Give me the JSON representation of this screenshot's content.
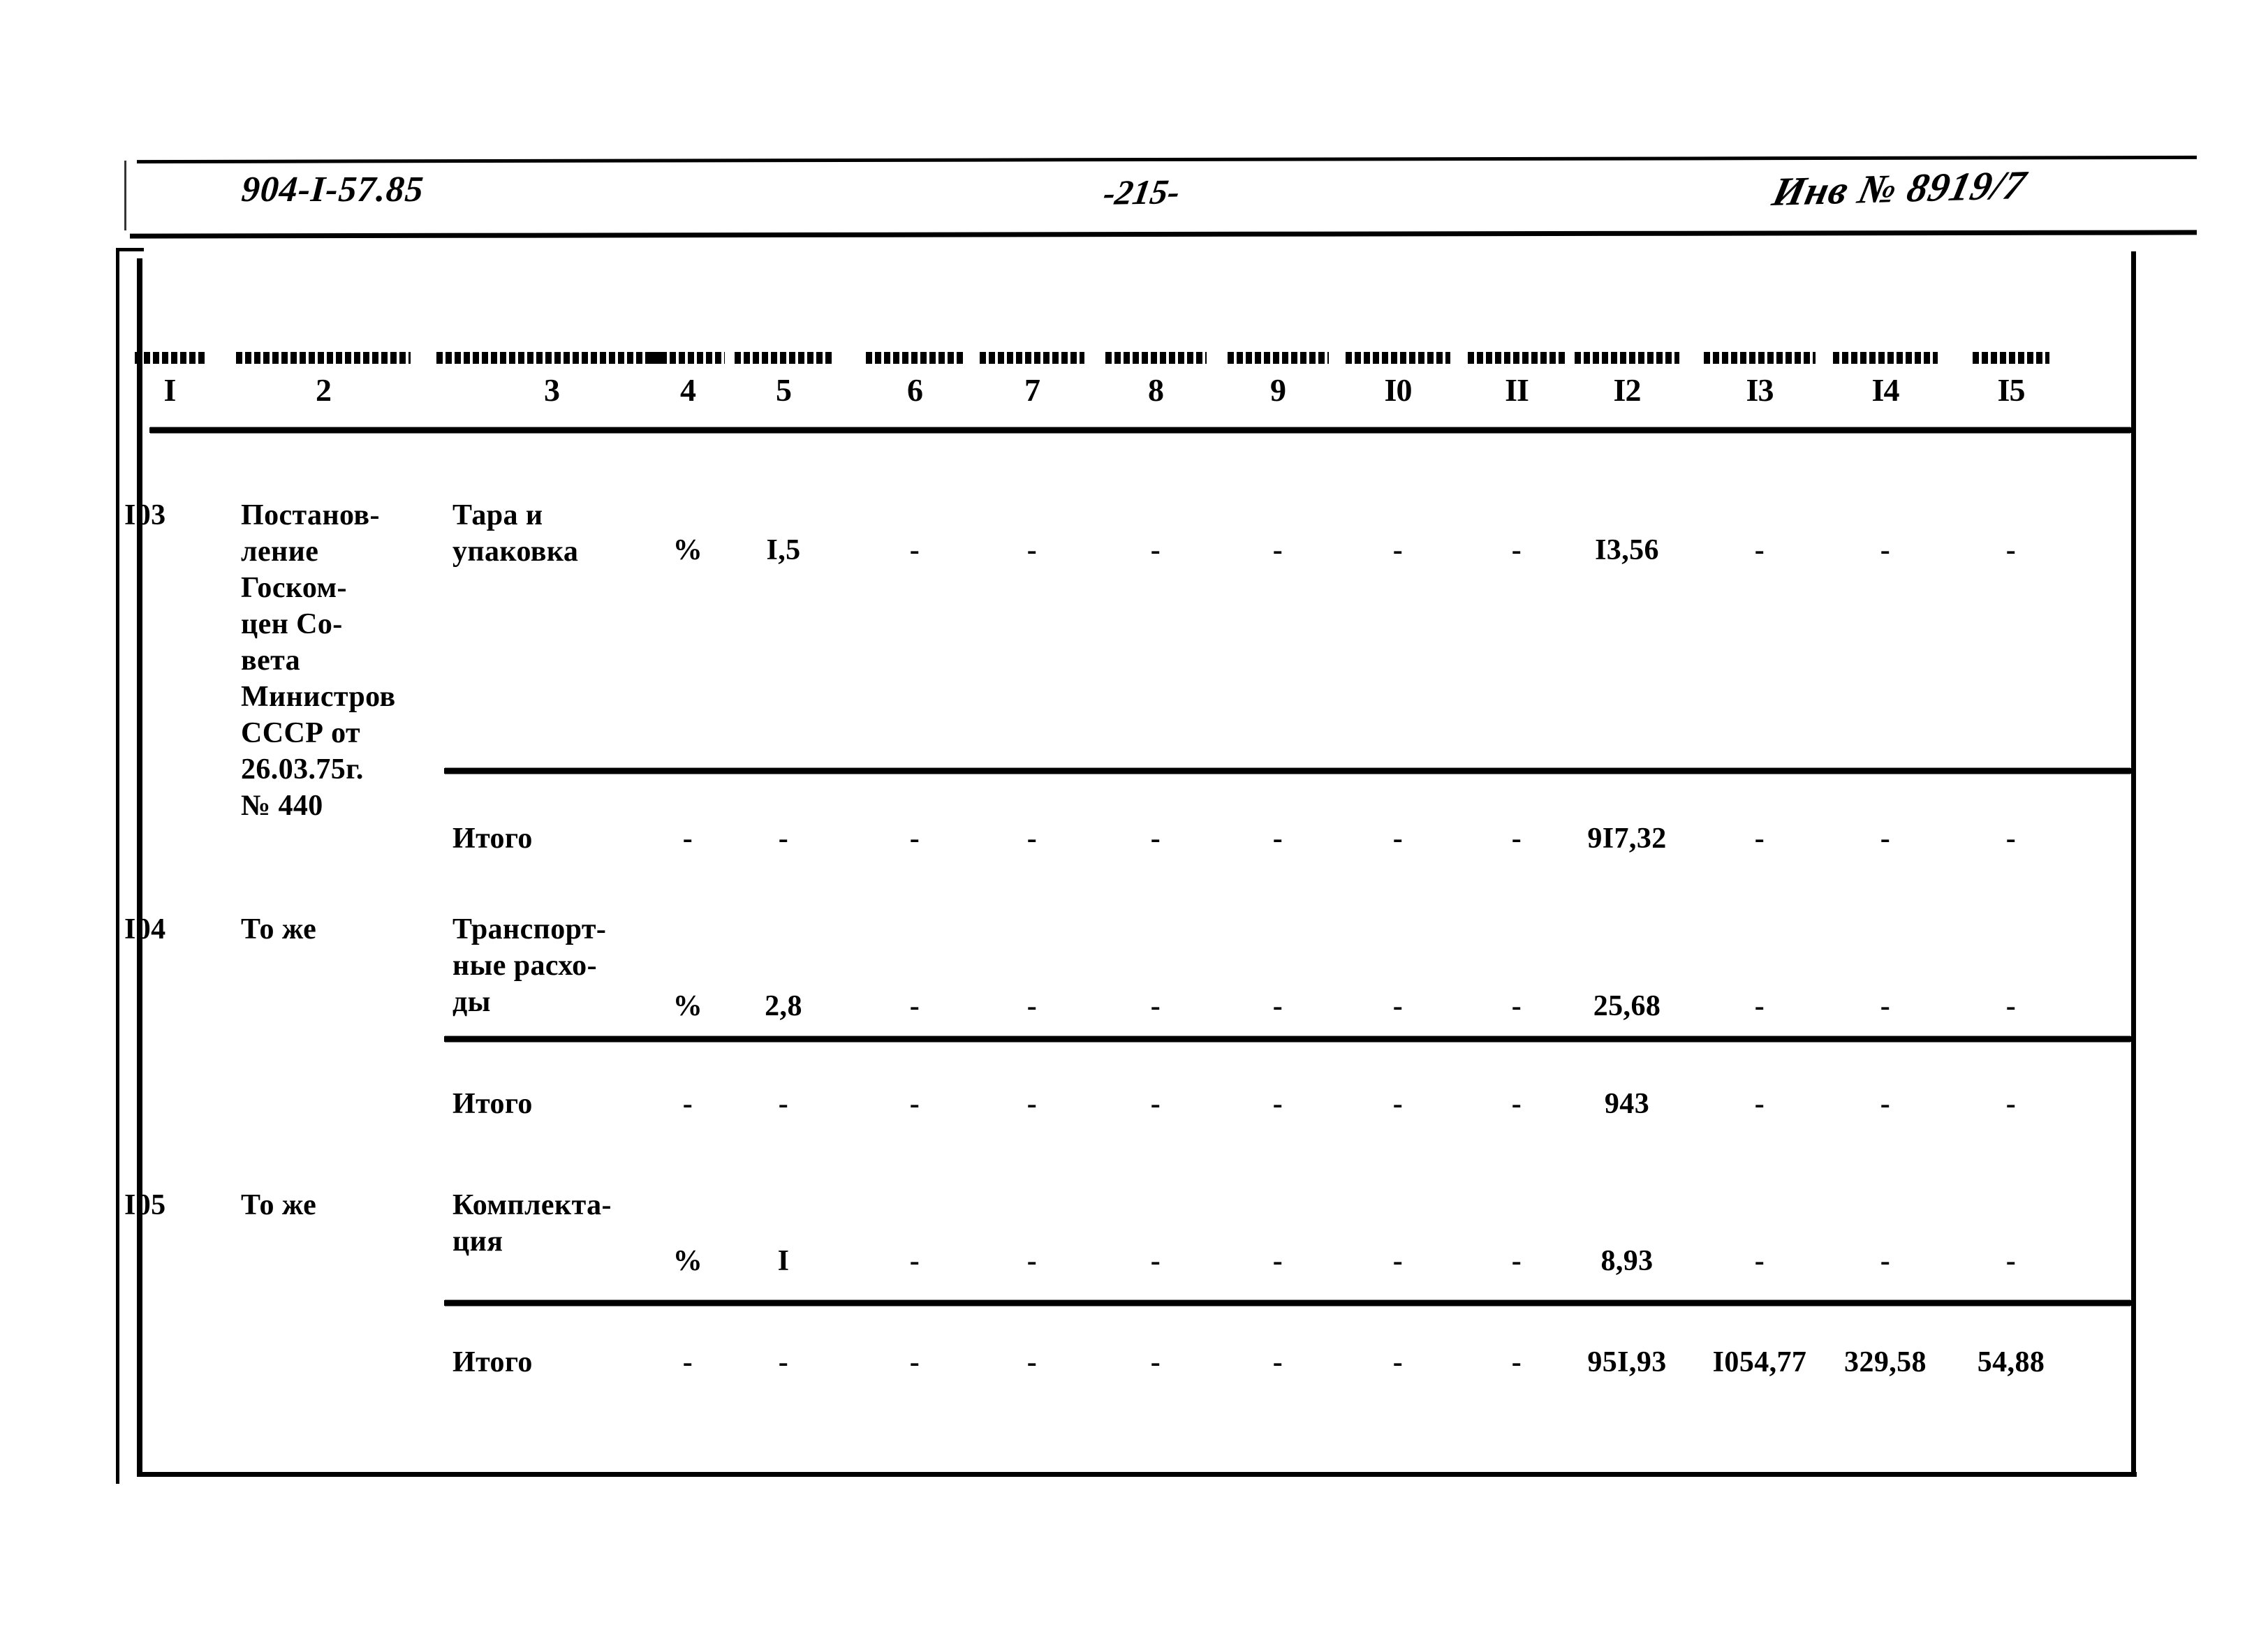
{
  "header": {
    "doc_code": "904-I-57.85",
    "page_number": "-215-",
    "inventory_number": "Инв № 8919/7"
  },
  "table": {
    "column_numbers": [
      "I",
      "2",
      "3",
      "4",
      "5",
      "6",
      "7",
      "8",
      "9",
      "I0",
      "II",
      "I2",
      "I3",
      "I4",
      "I5"
    ],
    "rows": [
      {
        "kind": "data",
        "c1": "I03",
        "c2": "Постанов-\nление\nГоском-\nцен Со-\nвета\nМинистров\nСССР от\n26.03.75г.\n№ 440",
        "c3": "Тара и\nупаковка",
        "c4": "%",
        "c5": "I,5",
        "c6": "-",
        "c7": "-",
        "c8": "-",
        "c9": "-",
        "c10": "-",
        "c11": "-",
        "c12": "I3,56",
        "c13": "-",
        "c14": "-",
        "c15": "-"
      },
      {
        "kind": "total",
        "c1": "",
        "c2": "",
        "c3": "Итого",
        "c4": "-",
        "c5": "-",
        "c6": "-",
        "c7": "-",
        "c8": "-",
        "c9": "-",
        "c10": "-",
        "c11": "-",
        "c12": "9I7,32",
        "c13": "-",
        "c14": "-",
        "c15": "-"
      },
      {
        "kind": "data",
        "c1": "I04",
        "c2": "То же",
        "c3": "Транспорт-\nные расхо-\nды",
        "c4": "%",
        "c5": "2,8",
        "c6": "-",
        "c7": "-",
        "c8": "-",
        "c9": "-",
        "c10": "-",
        "c11": "-",
        "c12": "25,68",
        "c13": "-",
        "c14": "-",
        "c15": "-"
      },
      {
        "kind": "total",
        "c1": "",
        "c2": "",
        "c3": "Итого",
        "c4": "-",
        "c5": "-",
        "c6": "-",
        "c7": "-",
        "c8": "-",
        "c9": "-",
        "c10": "-",
        "c11": "-",
        "c12": "943",
        "c13": "-",
        "c14": "-",
        "c15": "-"
      },
      {
        "kind": "data",
        "c1": "I05",
        "c2": "То же",
        "c3": "Комплекта-\nция",
        "c4": "%",
        "c5": "I",
        "c6": "-",
        "c7": "-",
        "c8": "-",
        "c9": "-",
        "c10": "-",
        "c11": "-",
        "c12": "8,93",
        "c13": "-",
        "c14": "-",
        "c15": "-"
      },
      {
        "kind": "total",
        "c1": "",
        "c2": "",
        "c3": "Итого",
        "c4": "-",
        "c5": "-",
        "c6": "-",
        "c7": "-",
        "c8": "-",
        "c9": "-",
        "c10": "-",
        "c11": "-",
        "c12": "95I,93",
        "c13": "I054,77",
        "c14": "329,58",
        "c15": "54,88"
      }
    ]
  }
}
